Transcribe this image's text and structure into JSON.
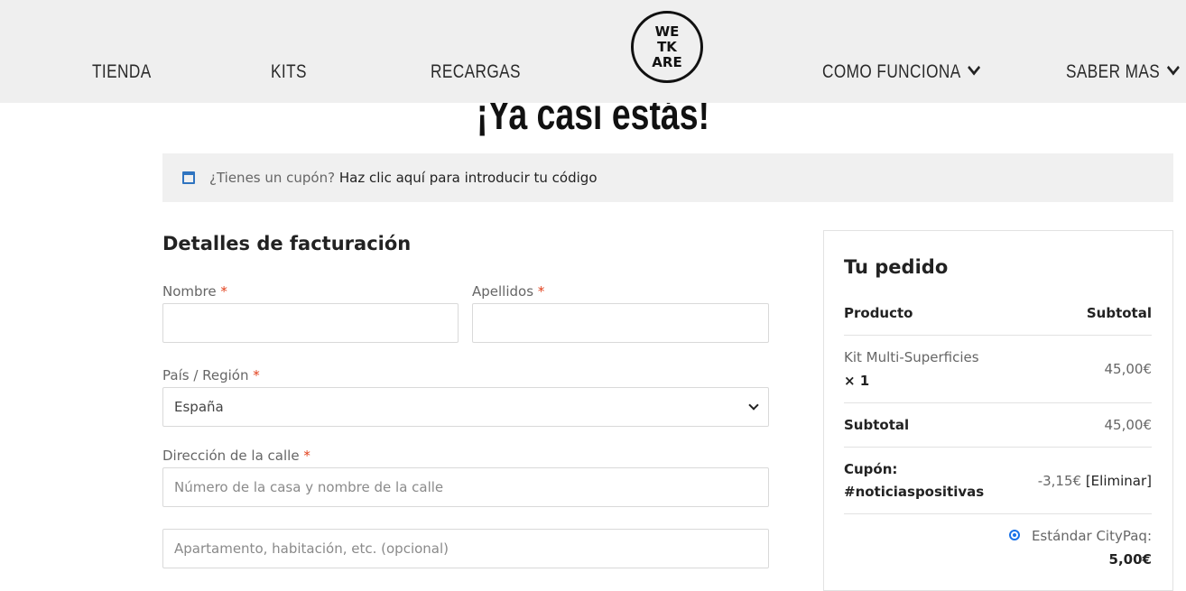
{
  "header": {
    "nav": {
      "tienda": "TIENDA",
      "kits": "KITS",
      "recargas": "RECARGAS",
      "como_funciona": "COMO FUNCIONA",
      "saber_mas": "SABER MAS"
    },
    "logo": {
      "line1": "WE",
      "line2": "TK",
      "line3": "ARE"
    }
  },
  "page": {
    "title": "¡Ya casi estás!"
  },
  "coupon_notice": {
    "question": "¿Tienes un cupón?",
    "link": "Haz clic aquí para introducir tu código"
  },
  "billing": {
    "title": "Detalles de facturación",
    "required_mark": "*",
    "first_name": {
      "label": "Nombre",
      "value": ""
    },
    "last_name": {
      "label": "Apellidos",
      "value": ""
    },
    "country": {
      "label": "País / Región",
      "value": "España"
    },
    "street": {
      "label": "Dirección de la calle",
      "placeholder": "Número de la casa y nombre de la calle",
      "placeholder2": "Apartamento, habitación, etc. (opcional)"
    }
  },
  "order": {
    "title": "Tu pedido",
    "header_product": "Producto",
    "header_subtotal": "Subtotal",
    "item_name": "Kit Multi-Superficies",
    "item_qty": "× 1",
    "item_price": "45,00€",
    "subtotal_label": "Subtotal",
    "subtotal_value": "45,00€",
    "coupon_label": "Cupón:",
    "coupon_code": "#noticiaspositivas",
    "coupon_amount": "-3,15€",
    "coupon_remove": "[Eliminar]",
    "shipping_option": "Estándar CityPaq:",
    "shipping_price": "5,00€"
  },
  "colors": {
    "header_bg": "#efefef",
    "required": "#e2401c",
    "accent": "#1a73e8",
    "coupon_icon": "#2f74c0"
  }
}
